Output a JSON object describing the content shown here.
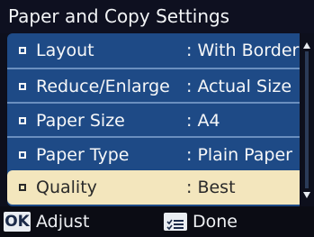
{
  "window": {
    "title": "Paper and Copy Settings"
  },
  "settings": [
    {
      "name": "Layout",
      "value": ": With Border",
      "selected": false
    },
    {
      "name": "Reduce/Enlarge",
      "value": ": Actual Size",
      "selected": false
    },
    {
      "name": "Paper Size",
      "value": ": A4",
      "selected": false
    },
    {
      "name": "Paper Type",
      "value": ": Plain Paper",
      "selected": false
    },
    {
      "name": "Quality",
      "value": ": Best",
      "selected": true
    }
  ],
  "footer": {
    "ok_key": "OK",
    "ok_label": "Adjust",
    "done_icon": "menu-list-icon",
    "done_label": "Done"
  },
  "icons": {
    "bullet": "square-bullet-icon",
    "scroll": "scroll-arrows-icon"
  },
  "colors": {
    "list_background": "#1e4a86",
    "selected_row": "#f3e6bd",
    "title_background": "#0e1020"
  }
}
